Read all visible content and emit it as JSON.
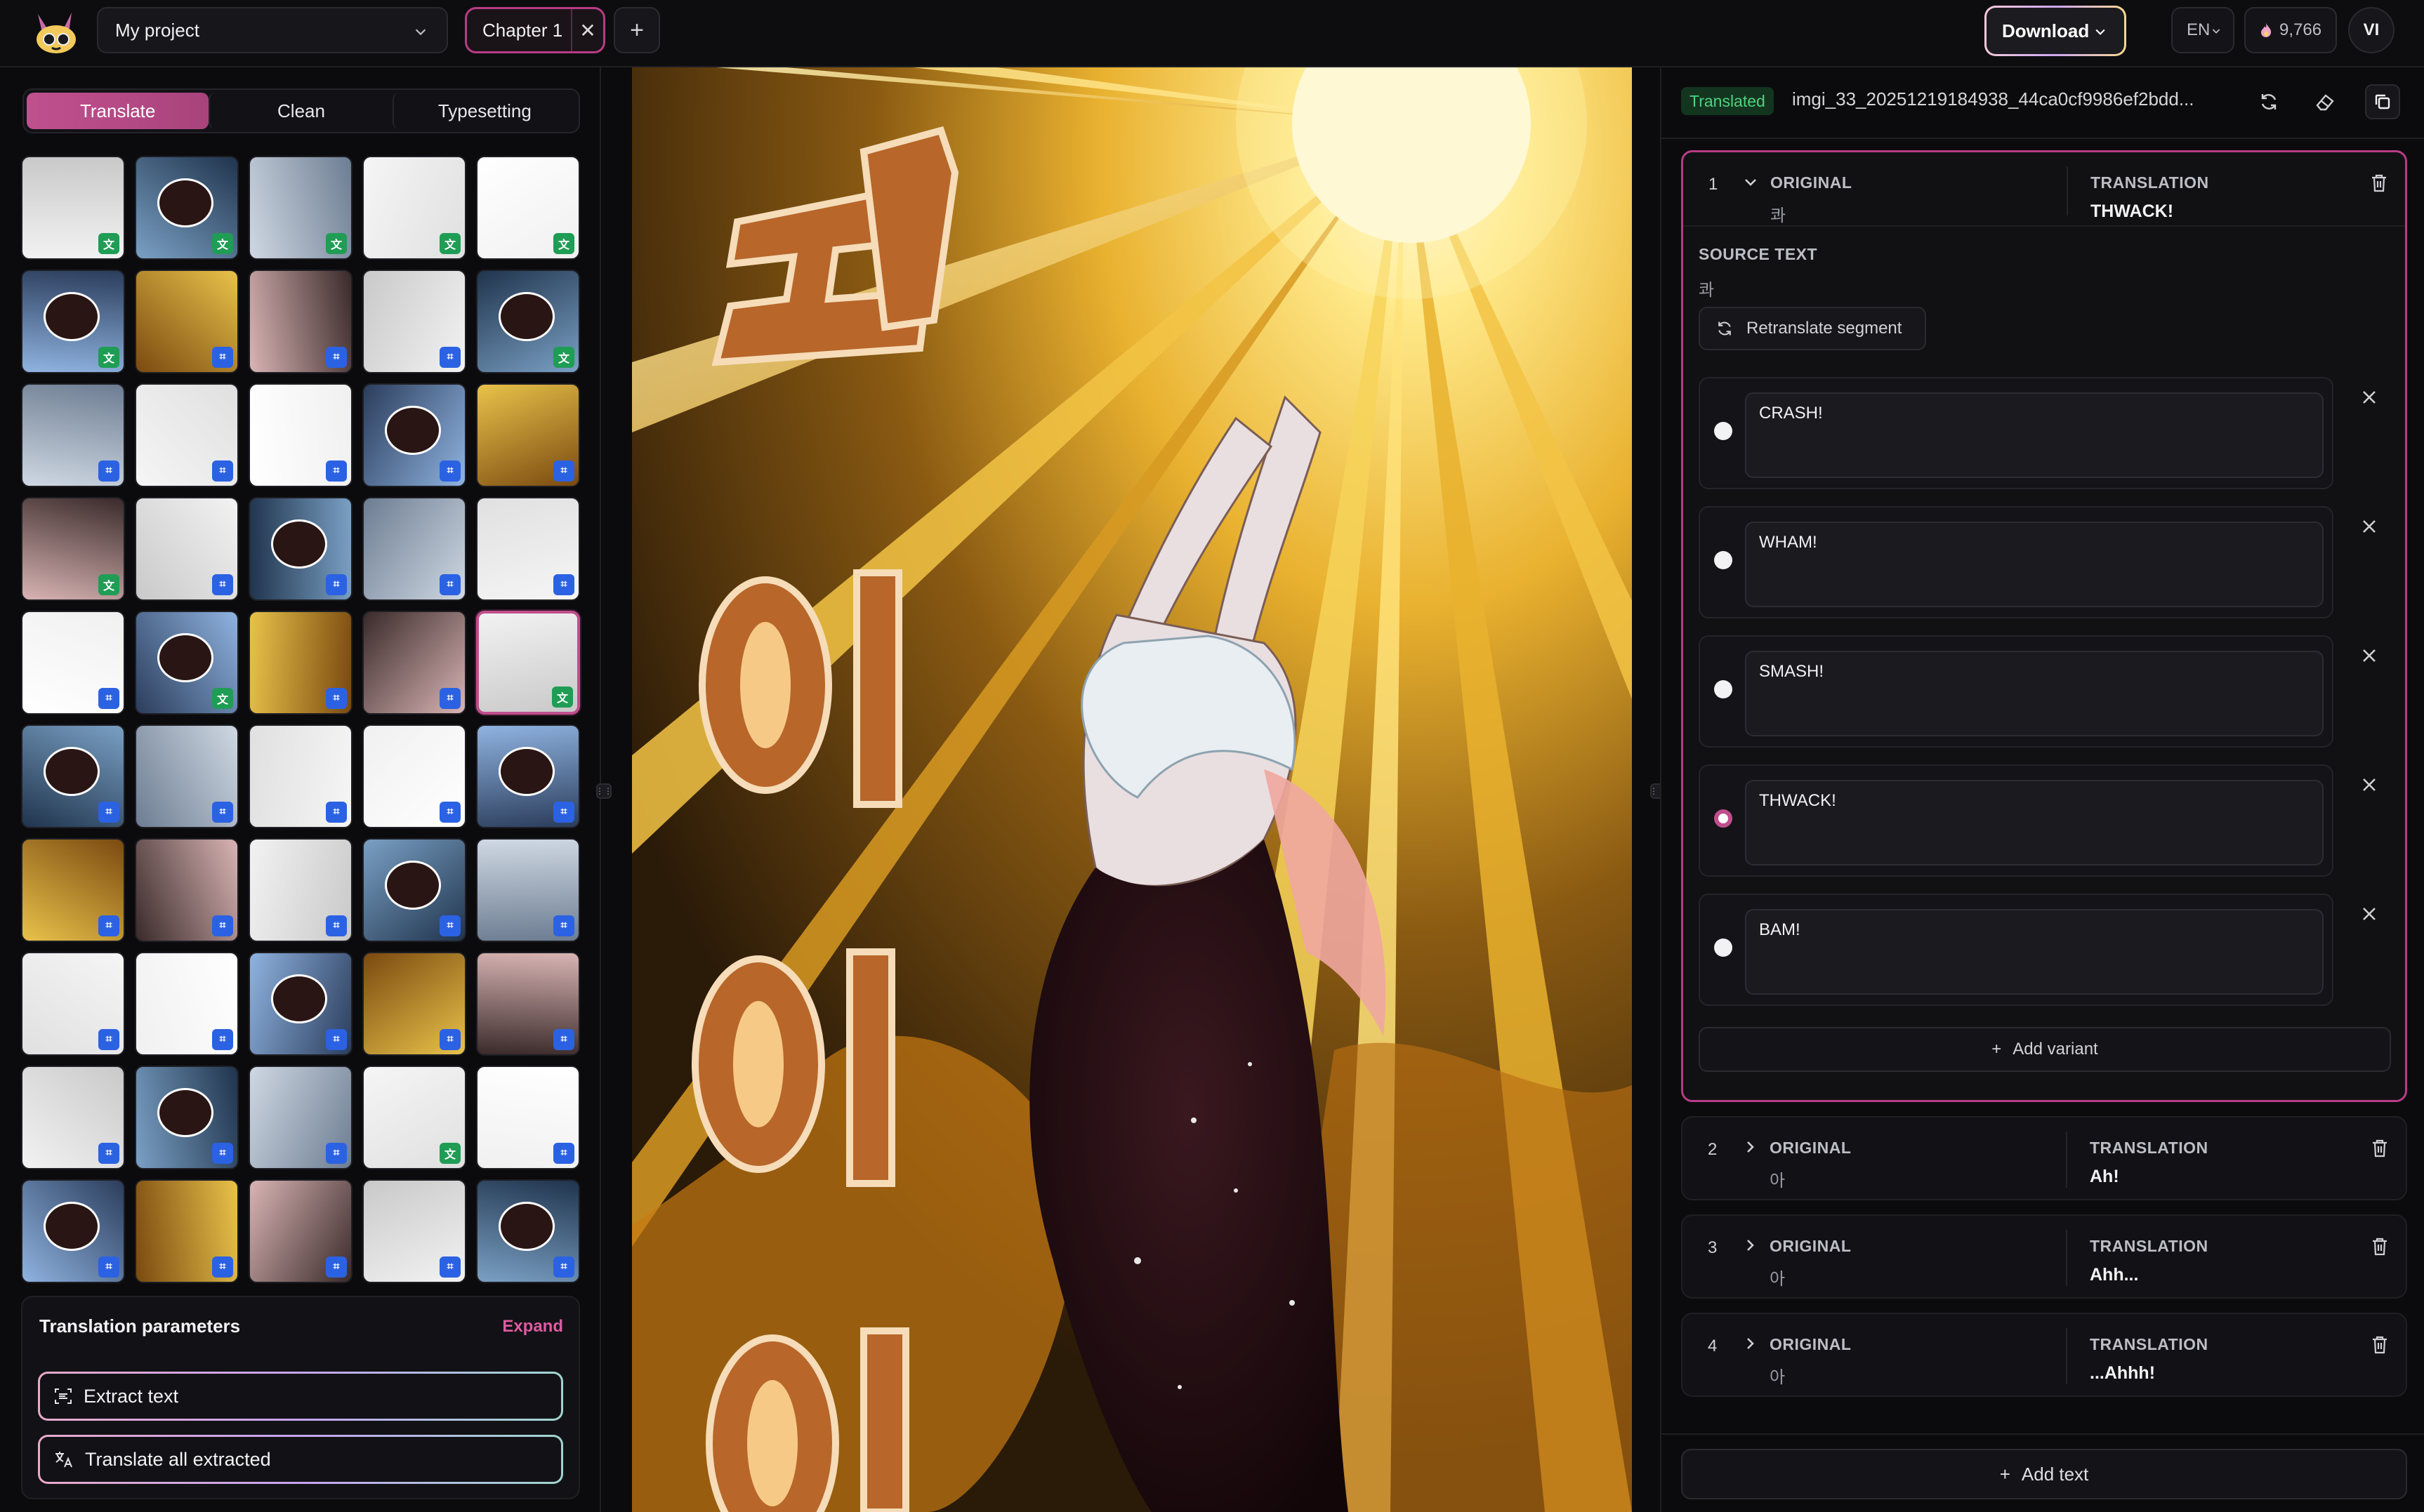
{
  "header": {
    "project": "My project",
    "chapter_tab": "Chapter 1",
    "download_label": "Download",
    "language": "EN",
    "credits": "9,766",
    "user_initials": "VI"
  },
  "left": {
    "tabs": [
      "Translate",
      "Clean",
      "Typesetting"
    ],
    "active_tab": "Translate",
    "thumbnails": [
      {
        "status": "translated"
      },
      {
        "status": "translated"
      },
      {
        "status": "translated"
      },
      {
        "status": "translated"
      },
      {
        "status": "translated"
      },
      {
        "status": "translated"
      },
      {
        "status": "extracted"
      },
      {
        "status": "extracted"
      },
      {
        "status": "extracted"
      },
      {
        "status": "translated"
      },
      {
        "status": "extracted"
      },
      {
        "status": "extracted"
      },
      {
        "status": "extracted"
      },
      {
        "status": "extracted"
      },
      {
        "status": "extracted"
      },
      {
        "status": "translated"
      },
      {
        "status": "extracted"
      },
      {
        "status": "extracted"
      },
      {
        "status": "extracted"
      },
      {
        "status": "extracted"
      },
      {
        "status": "extracted"
      },
      {
        "status": "translated"
      },
      {
        "status": "extracted"
      },
      {
        "status": "extracted"
      },
      {
        "status": "translated",
        "selected": true
      },
      {
        "status": "extracted"
      },
      {
        "status": "extracted"
      },
      {
        "status": "extracted"
      },
      {
        "status": "extracted"
      },
      {
        "status": "extracted"
      },
      {
        "status": "extracted"
      },
      {
        "status": "extracted"
      },
      {
        "status": "extracted"
      },
      {
        "status": "extracted"
      },
      {
        "status": "extracted"
      },
      {
        "status": "extracted"
      },
      {
        "status": "extracted"
      },
      {
        "status": "extracted"
      },
      {
        "status": "extracted"
      },
      {
        "status": "extracted"
      },
      {
        "status": "extracted"
      },
      {
        "status": "extracted"
      },
      {
        "status": "extracted"
      },
      {
        "status": "translated"
      },
      {
        "status": "extracted"
      },
      {
        "status": "extracted"
      },
      {
        "status": "extracted"
      },
      {
        "status": "extracted"
      },
      {
        "status": "extracted"
      },
      {
        "status": "extracted"
      }
    ],
    "params": {
      "title": "Translation parameters",
      "expand": "Expand",
      "extract_btn": "Extract text",
      "translate_all_btn": "Translate all extracted"
    }
  },
  "right": {
    "status": "Translated",
    "file_name": "imgi_33_20251219184938_44ca0cf9986ef2bdd...",
    "col_original": "ORIGINAL",
    "col_translation": "TRANSLATION",
    "source_text_label": "SOURCE TEXT",
    "retranslate_label": "Retranslate segment",
    "add_variant_label": "Add variant",
    "add_text_label": "Add text",
    "segments": [
      {
        "num": "1",
        "original": "콰",
        "translation": "THWACK!",
        "source_text": "콰",
        "variants": [
          {
            "text": "CRASH!",
            "selected": false
          },
          {
            "text": "WHAM!",
            "selected": false
          },
          {
            "text": "SMASH!",
            "selected": false
          },
          {
            "text": "THWACK!",
            "selected": true
          },
          {
            "text": "BAM!",
            "selected": false
          }
        ]
      },
      {
        "num": "2",
        "original": "아",
        "translation": "Ah!"
      },
      {
        "num": "3",
        "original": "아",
        "translation": "Ahh..."
      },
      {
        "num": "4",
        "original": "아",
        "translation": "...Ahhh!"
      }
    ]
  },
  "colors": {
    "accent": "#c04e8c",
    "translated_badge": "#1f9d55",
    "extracted_badge": "#2b62e3",
    "status_green": "#4fd27f"
  }
}
